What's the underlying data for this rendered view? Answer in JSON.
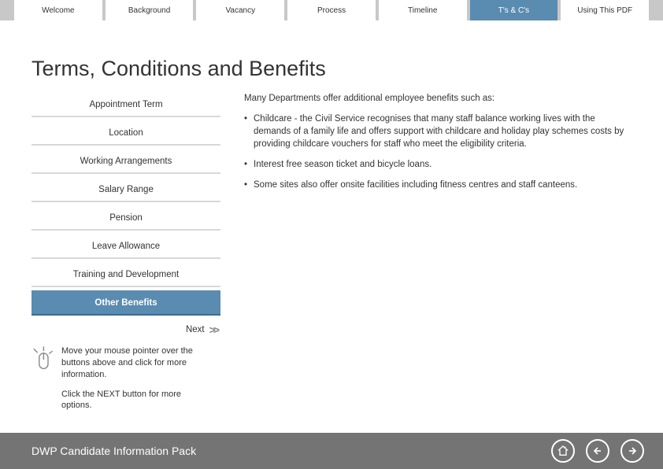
{
  "nav": {
    "tabs": [
      {
        "label": "Welcome",
        "active": false
      },
      {
        "label": "Background",
        "active": false
      },
      {
        "label": "Vacancy",
        "active": false
      },
      {
        "label": "Process",
        "active": false
      },
      {
        "label": "Timeline",
        "active": false
      },
      {
        "label": "T's & C's",
        "active": true
      },
      {
        "label": "Using This PDF",
        "active": false
      }
    ]
  },
  "page": {
    "title": "Terms, Conditions and Benefits"
  },
  "sidebar": {
    "items": [
      {
        "label": "Appointment Term",
        "active": false
      },
      {
        "label": "Location",
        "active": false
      },
      {
        "label": "Working Arrangements",
        "active": false
      },
      {
        "label": "Salary Range",
        "active": false
      },
      {
        "label": "Pension",
        "active": false
      },
      {
        "label": "Leave Allowance",
        "active": false
      },
      {
        "label": "Training and Development",
        "active": false
      },
      {
        "label": "Other Benefits",
        "active": true
      }
    ],
    "next_label": "Next"
  },
  "hints": {
    "line1": "Move your mouse pointer over the buttons above and click for more information.",
    "line2": "Click the NEXT button for more options."
  },
  "content": {
    "intro": "Many Departments offer additional employee benefits such as:",
    "bullets": [
      "Childcare - the Civil Service recognises that many staff balance working lives with the demands of a family life and offers support with childcare and holiday play schemes costs by providing childcare vouchers for staff who meet the eligibility criteria.",
      "Interest free season ticket and bicycle loans.",
      "Some sites also offer onsite facilities including fitness centres and staff canteens."
    ]
  },
  "footer": {
    "title": "DWP Candidate Information Pack"
  }
}
